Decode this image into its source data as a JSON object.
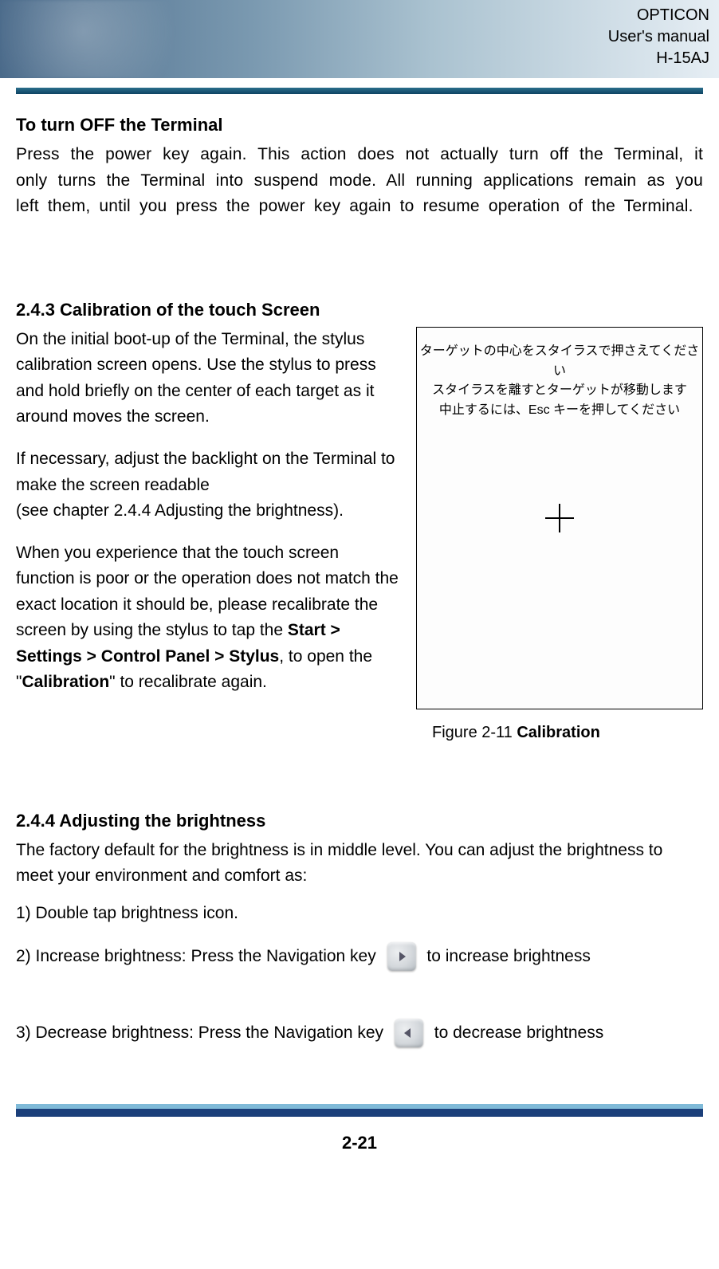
{
  "header": {
    "brand": "OPTICON",
    "line2": "User's manual",
    "model": "H-15AJ"
  },
  "sec1": {
    "title": "To turn OFF the Terminal",
    "body": "Press the power key again. This action does not actually turn off the Terminal, it only turns the Terminal into suspend mode. All running applications remain as you left them, until you press the power key again to resume operation of the Terminal."
  },
  "sec2": {
    "title": "2.4.3 Calibration of the touch Screen",
    "p1": "On the initial boot-up of the Terminal, the stylus calibration screen opens. Use the stylus to press and hold briefly on the center of each target as it around moves the screen.",
    "p2": "If necessary, adjust the backlight on the Terminal to make the screen readable",
    "p2b": "(see chapter 2.4.4 Adjusting the brightness).",
    "p3_pre": "When you experience that the touch screen function is poor or the operation does not match the exact location it should be, please recalibrate the screen by using the stylus to tap the ",
    "p3_bold1": "Start > Settings > Control Panel > Stylus",
    "p3_mid": ", to open the \"",
    "p3_bold2": "Calibration",
    "p3_post": "\" to recalibrate again.",
    "calib_jp1": "ターゲットの中心をスタイラスで押さえてください",
    "calib_jp2": "スタイラスを離すとターゲットが移動します",
    "calib_jp3": "中止するには、Esc キーを押してください",
    "caption_pre": "Figure 2-11 ",
    "caption_bold": "Calibration"
  },
  "sec3": {
    "title": "2.4.4 Adjusting the brightness",
    "intro": "The factory default for the brightness is in middle level. You can adjust the brightness to meet your environment and comfort as:",
    "step1": "1) Double tap brightness icon.",
    "step2a": "2) Increase brightness: Press the Navigation key ",
    "step2b": " to increase brightness",
    "step3a": "3) Decrease brightness: Press the Navigation key ",
    "step3b": " to decrease brightness"
  },
  "footer": {
    "page": "2-21"
  }
}
